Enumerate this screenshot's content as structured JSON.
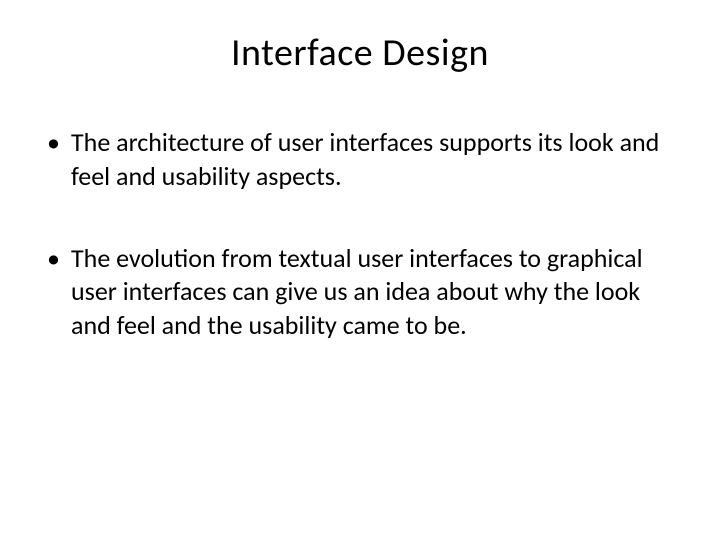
{
  "slide": {
    "title": "Interface Design",
    "bullets": [
      "The architecture of user interfaces supports its look and feel and usability aspects.",
      "The evolution from textual user interfaces to graphical user interfaces can give us an idea about why the look and feel and the usability came to be."
    ]
  }
}
